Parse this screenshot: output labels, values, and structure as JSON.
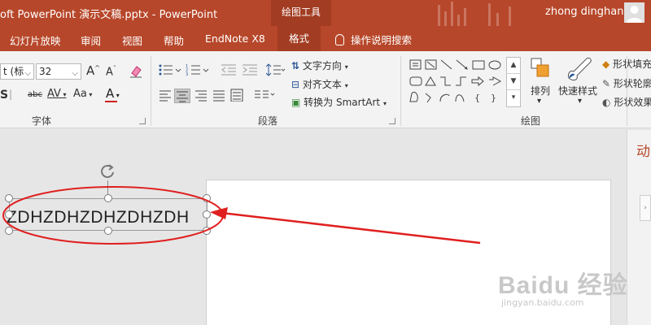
{
  "titlebar": {
    "doc_title": "oft PowerPoint 演示文稿.pptx  -  PowerPoint",
    "context_tab": "绘图工具",
    "user_name": "zhong dinghan"
  },
  "tabs": [
    {
      "label": "幻灯片放映"
    },
    {
      "label": "审阅"
    },
    {
      "label": "视图"
    },
    {
      "label": "帮助"
    },
    {
      "label": "EndNote X8"
    },
    {
      "label": "格式",
      "active": true
    }
  ],
  "tell_me": "操作说明搜索",
  "font_group": {
    "label": "字体",
    "font_name": "t (标",
    "font_size": "32",
    "grow_font": "A",
    "shrink_font": "A",
    "strike_label": "abc",
    "spacing_label": "AV",
    "case_label": "Aa",
    "color_label": "A",
    "bold_label": "S"
  },
  "paragraph_group": {
    "label": "段落",
    "text_direction": "文字方向",
    "align_text": "对齐文本",
    "convert_smartart": "转换为 SmartArt"
  },
  "drawing_group": {
    "label": "绘图",
    "arrange": "排列",
    "quick_styles": "快速样式",
    "shape_fill": "形状填充",
    "shape_outline": "形状轮廓",
    "shape_effects": "形状效果"
  },
  "slide": {
    "textbox_text": "ZDHZDHZDHZDHZDH"
  },
  "pane": {
    "title": "动"
  },
  "watermark": {
    "main": "Baidu 经验",
    "sub": "jingyan.baidu.com"
  },
  "colors": {
    "accent": "#b7472a",
    "annotation": "#e02020"
  }
}
